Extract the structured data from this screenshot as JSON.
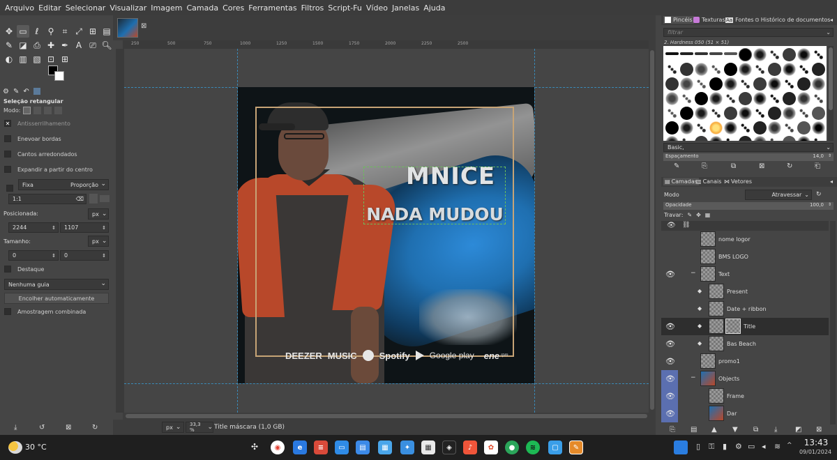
{
  "menu": [
    "Arquivo",
    "Editar",
    "Selecionar",
    "Visualizar",
    "Imagem",
    "Camada",
    "Cores",
    "Ferramentas",
    "Filtros",
    "Script-Fu",
    "Vídeo",
    "Janelas",
    "Ajuda"
  ],
  "tool_options": {
    "title": "Seleção retangular",
    "mode_label": "Modo:",
    "antialias": "Antisserrilhamento",
    "feather": "Enevoar bordas",
    "rounded": "Cantos arredondados",
    "expand": "Expandir a partir do centro",
    "fixed": "Fixa",
    "proportion": "Proporção",
    "ratio": "1:1",
    "position_label": "Posicionada:",
    "position_unit": "px",
    "pos_x": "2244",
    "pos_y": "1107",
    "size_label": "Tamanho:",
    "size_unit": "px",
    "size_w": "0",
    "size_h": "0",
    "highlight": "Destaque",
    "guides": "Nenhuma guia",
    "auto_shrink": "Encolher automaticamente",
    "sample_merged": "Amostragem combinada"
  },
  "ruler_marks": [
    "250",
    "500",
    "750",
    "1000",
    "1250",
    "1500",
    "1750",
    "2000",
    "2250",
    "2500"
  ],
  "poster": {
    "artist": "MNICE",
    "title": "NADA MUDOU",
    "logos": [
      "DEEZER",
      "MUSIC",
      "Spotify",
      "Google play",
      "ene"
    ],
    "logo_sub": "rpm"
  },
  "status": {
    "unit": "px",
    "zoom": "33,3 %",
    "info": "Title máscara (1,0 GB)"
  },
  "dock": {
    "tabs": [
      "Pincéis",
      "Texturas",
      "Fontes",
      "Histórico de documentos"
    ],
    "filter_placeholder": "filtrar",
    "brush_name": "2. Hardness 050 (51 × 51)",
    "preset": "Basic,",
    "spacing_label": "Espaçamento",
    "spacing_value": "14,0",
    "layer_tabs": [
      "Camadas",
      "Canais",
      "Vetores"
    ],
    "mode_label": "Modo",
    "mode_value": "Atravessar",
    "opacity_label": "Opacidade",
    "opacity_value": "100,0",
    "lock_label": "Travar:",
    "layers": [
      {
        "name": "nome logor",
        "visible": false,
        "indent": 0,
        "expander": "",
        "chain": false
      },
      {
        "name": "BMS LOGO",
        "visible": false,
        "indent": 0,
        "expander": "",
        "chain": false
      },
      {
        "name": "Text",
        "visible": true,
        "indent": 0,
        "expander": "−",
        "chain": false
      },
      {
        "name": "Present",
        "visible": false,
        "indent": 1,
        "expander": "",
        "chain": true
      },
      {
        "name": "Date + ribbon",
        "visible": false,
        "indent": 1,
        "expander": "",
        "chain": true
      },
      {
        "name": "Title",
        "visible": true,
        "indent": 1,
        "expander": "",
        "chain": true,
        "selected": true,
        "mask": true
      },
      {
        "name": "Bas Beach",
        "visible": true,
        "indent": 1,
        "expander": "",
        "chain": true
      },
      {
        "name": "promo1",
        "visible": true,
        "indent": 0,
        "expander": "",
        "chain": false
      },
      {
        "name": "Objects",
        "visible": true,
        "indent": 0,
        "expander": "−",
        "chain": false,
        "highlight": true,
        "photo": true
      },
      {
        "name": "Frame",
        "visible": true,
        "indent": 1,
        "expander": "",
        "chain": false,
        "highlight": true
      },
      {
        "name": "Dar",
        "visible": true,
        "indent": 1,
        "expander": "",
        "chain": false,
        "highlight": true,
        "photo": true
      }
    ]
  },
  "taskbar": {
    "weather": "30 °C",
    "time": "13:43",
    "date": "09/01/2024"
  },
  "colors": {
    "blue_accent": "#1f6fb0",
    "shirt": "#b8482a",
    "frame": "#c7a476"
  }
}
